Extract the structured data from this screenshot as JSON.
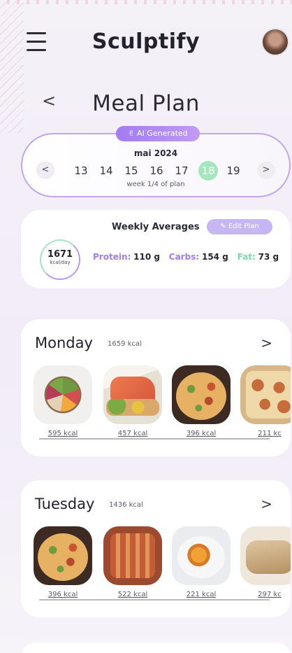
{
  "header": {
    "app_title": "Sculptify"
  },
  "page": {
    "title": "Meal Plan",
    "back_label": "<"
  },
  "calendar": {
    "badge": "✌ AI Generated",
    "month": "mai 2024",
    "days": [
      "13",
      "14",
      "15",
      "16",
      "17",
      "18",
      "19"
    ],
    "active_day": "18",
    "prev_label": "<",
    "next_label": ">",
    "week_text": "week 1/4 of plan"
  },
  "averages": {
    "title": "Weekly Averages",
    "edit_label": "✎ Edit Plan",
    "kcal": "1671",
    "kcal_unit": "kcal/day",
    "protein_label": "Protein:",
    "protein_value": "110 g",
    "carbs_label": "Carbs:",
    "carbs_value": "154 g",
    "fat_label": "Fat:",
    "fat_value": "73 g"
  },
  "days": [
    {
      "name": "Monday",
      "kcal": "1659 kcal",
      "arrow": ">",
      "meals": [
        {
          "icon": "bowl-meal-photo",
          "kcal": "595 kcal"
        },
        {
          "icon": "salmon-meal-photo",
          "kcal": "457 kcal"
        },
        {
          "icon": "pizza-meal-photo",
          "kcal": "396 kcal"
        },
        {
          "icon": "tray-bake-photo",
          "kcal": "211 kc"
        }
      ]
    },
    {
      "name": "Tuesday",
      "kcal": "1436 kcal",
      "arrow": ">",
      "meals": [
        {
          "icon": "pizza-meal-photo",
          "kcal": "396 kcal"
        },
        {
          "icon": "lasagna-meal-photo",
          "kcal": "522 kcal"
        },
        {
          "icon": "plate-meal-photo",
          "kcal": "221 kcal"
        },
        {
          "icon": "wrap-meal-photo",
          "kcal": "297 kc"
        }
      ]
    }
  ],
  "colors": {
    "accent_purple": "#a27bf2",
    "accent_green": "#a4e6be",
    "text_dark": "#22222e"
  }
}
